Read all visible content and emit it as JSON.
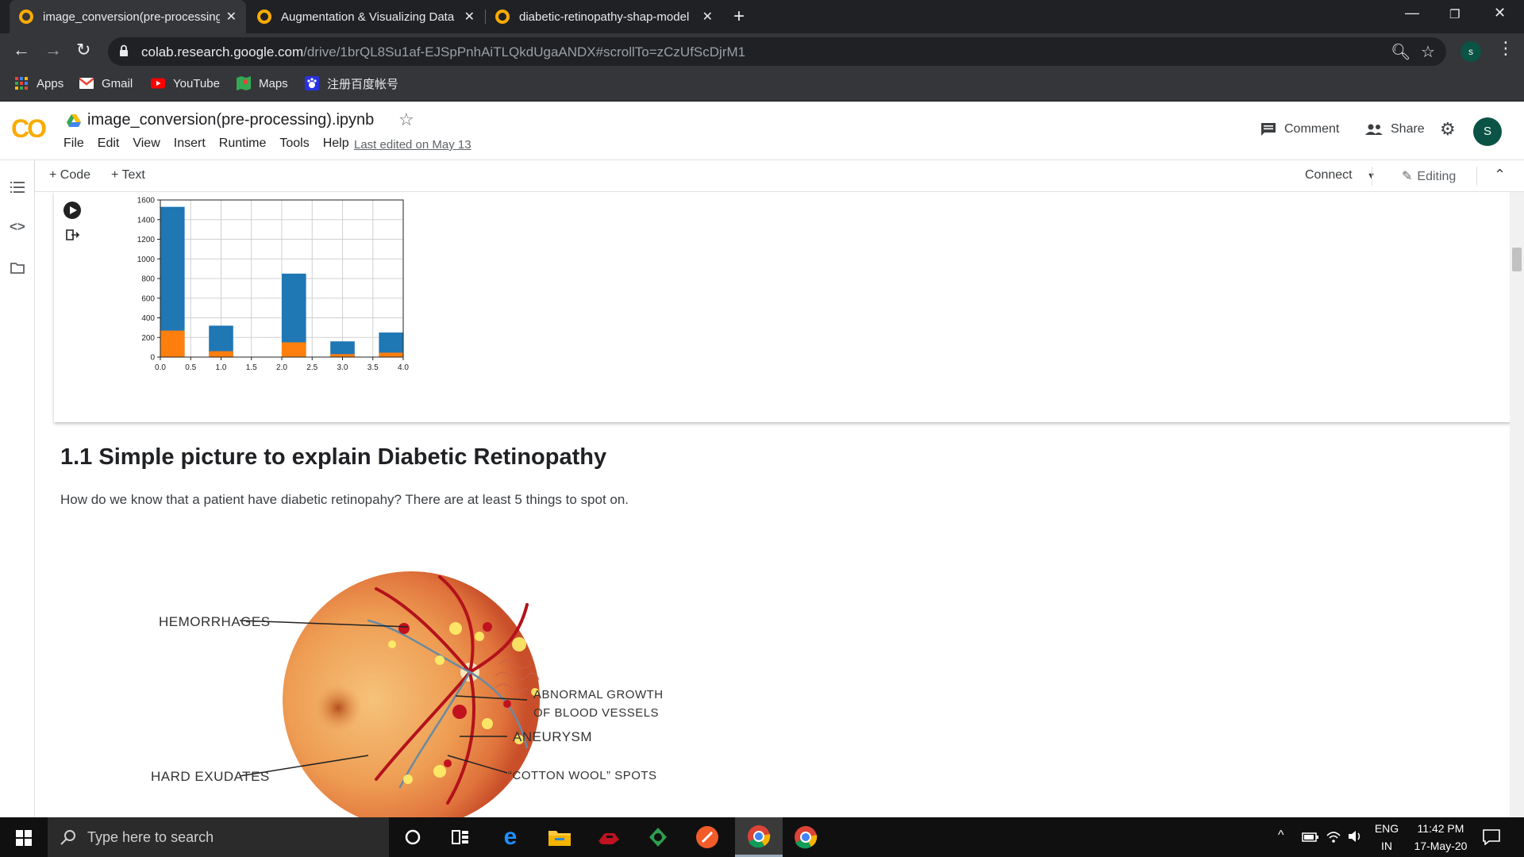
{
  "browser": {
    "tabs": [
      {
        "title": "image_conversion(pre-processing",
        "active": true
      },
      {
        "title": "Augmentation & Visualizing Data",
        "active": false
      },
      {
        "title": "diabetic-retinopathy-shap-model",
        "active": false
      }
    ],
    "url_host": "colab.research.google.com",
    "url_path": "/drive/1brQL8Su1af-EJSpPnhAiTLQkdUgaANDX#scrollTo=zCzUfScDjrM1",
    "profile_initial": "s",
    "bookmarks": [
      "Apps",
      "Gmail",
      "YouTube",
      "Maps",
      "注册百度帐号"
    ]
  },
  "colab": {
    "logo": "CO",
    "notebook_title": "image_conversion(pre-processing).ipynb",
    "menu": [
      "File",
      "Edit",
      "View",
      "Insert",
      "Runtime",
      "Tools",
      "Help"
    ],
    "last_edited": "Last edited on May 13",
    "comment_label": "Comment",
    "share_label": "Share",
    "avatar_initial": "S",
    "toolbar": {
      "add_code": "+ Code",
      "add_text": "+ Text",
      "connect": "Connect",
      "editing": "Editing"
    }
  },
  "chart_data": {
    "type": "bar",
    "title": "",
    "xlabel": "",
    "ylabel": "",
    "xlim": [
      0,
      4
    ],
    "ylim": [
      0,
      1600
    ],
    "xticks": [
      "0.0",
      "0.5",
      "1.0",
      "1.5",
      "2.0",
      "2.5",
      "3.0",
      "3.5",
      "4.0"
    ],
    "yticks": [
      "0",
      "200",
      "400",
      "600",
      "800",
      "1000",
      "1200",
      "1400",
      "1600"
    ],
    "grid": true,
    "stacked": false,
    "series": [
      {
        "color": "#1f77b4",
        "bins": [
          [
            0.0,
            0.4
          ],
          [
            0.8,
            1.2
          ],
          [
            2.0,
            2.4
          ],
          [
            2.8,
            3.2
          ],
          [
            3.6,
            4.0
          ]
        ],
        "values": [
          1530,
          320,
          850,
          160,
          250
        ]
      },
      {
        "color": "#ff7f0e",
        "bins": [
          [
            0.0,
            0.4
          ],
          [
            0.8,
            1.2
          ],
          [
            2.0,
            2.4
          ],
          [
            2.8,
            3.2
          ],
          [
            3.6,
            4.0
          ]
        ],
        "values": [
          270,
          60,
          150,
          30,
          45
        ]
      }
    ]
  },
  "markdown": {
    "heading": "1.1 Simple picture to explain Diabetic Retinopathy",
    "paragraph": "How do we know that a patient have diabetic retinopahy? There are at least 5 things to spot on.",
    "figure_labels": {
      "hemorrhages": "HEMORRHAGES",
      "abnormal_growth_1": "ABNORMAL GROWTH",
      "abnormal_growth_2": "OF BLOOD VESSELS",
      "aneurysm": "ANEURYSM",
      "hard_exudates": "HARD EXUDATES",
      "cotton_wool": "“COTTON WOOL” SPOTS"
    }
  },
  "taskbar": {
    "search_placeholder": "Type here to search",
    "lang_1": "ENG",
    "lang_2": "IN",
    "time": "11:42 PM",
    "date": "17-May-20"
  },
  "colors": {
    "colab_orange": "#f9ab00",
    "chrome_dark": "#202124",
    "chart_blue": "#1f77b4",
    "chart_orange": "#ff7f0e"
  }
}
